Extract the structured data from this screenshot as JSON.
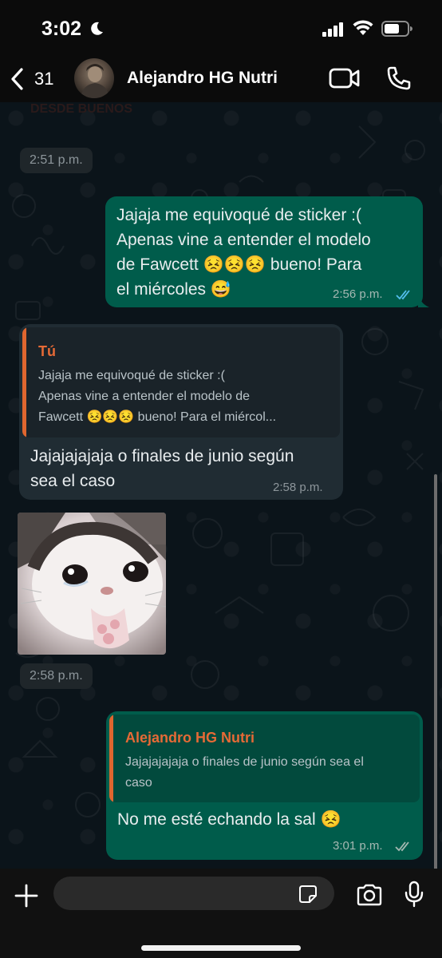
{
  "status": {
    "time": "3:02"
  },
  "header": {
    "back_count": "31",
    "contact_name": "Alejandro HG Nutri"
  },
  "chat": {
    "faded_text": "DESDE BUENOS",
    "pill_1": "2:51 p.m.",
    "msg1": {
      "lines": [
        "Jajaja me equivoqué de sticker :(",
        "Apenas vine a entender el modelo",
        "de Fawcett 😣😣😣 bueno! Para",
        "el miércoles 😅"
      ],
      "time": "2:56 p.m."
    },
    "msg2": {
      "quote_author": "Tú",
      "quote_lines": [
        "Jajaja me equivoqué de sticker :(",
        "Apenas vine a entender el modelo de",
        "Fawcett 😣😣😣 bueno! Para el miércol..."
      ],
      "lines": [
        "Jajajajajaja o finales de junio según",
        "sea el caso"
      ],
      "time": "2:58 p.m."
    },
    "pill_2": "2:58 p.m.",
    "msg3": {
      "quote_author": "Alejandro HG Nutri",
      "quote_lines": [
        "Jajajajajaja o finales de junio según sea el",
        "caso"
      ],
      "lines": [
        "No me esté echando la sal 😣"
      ],
      "time": "3:01 p.m."
    }
  },
  "input": {
    "placeholder": ""
  },
  "colors": {
    "outgoing": "#005c4b",
    "incoming": "#202c33",
    "quote_author": "#e66a36",
    "read_ticks": "#53bdeb"
  }
}
